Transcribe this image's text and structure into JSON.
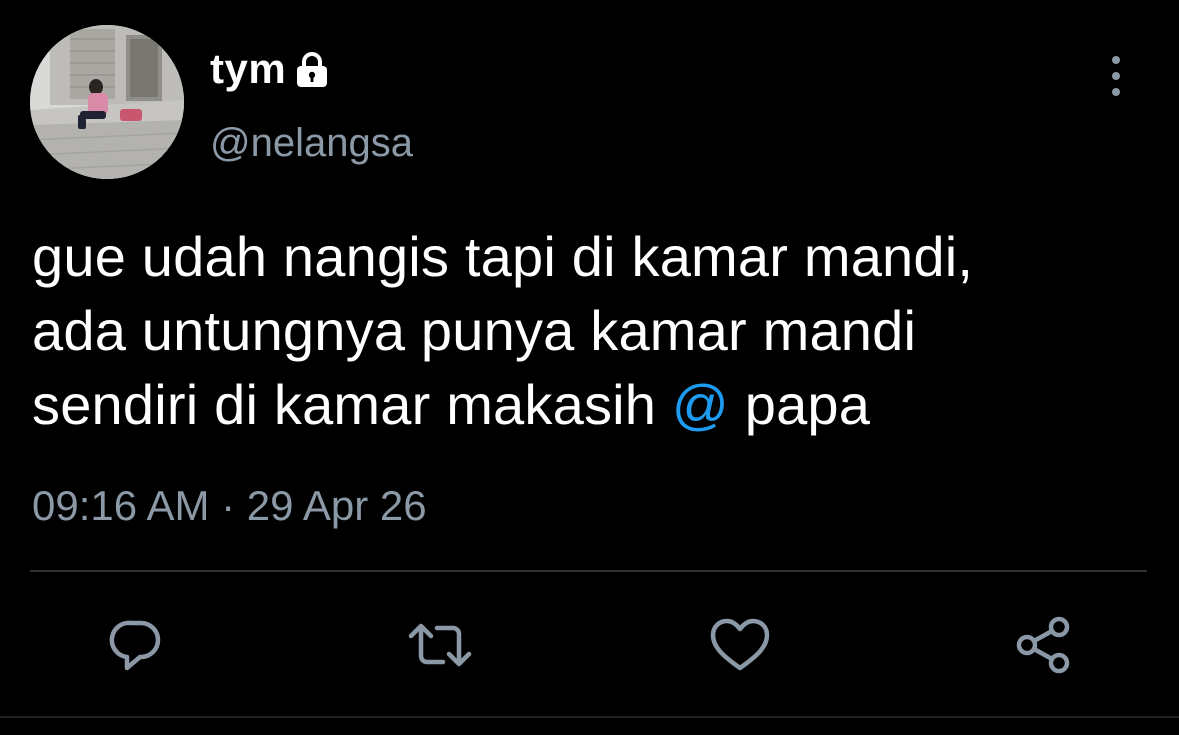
{
  "author": {
    "display_name": "tym",
    "handle": "@nelangsa",
    "protected_icon": "lock-icon",
    "avatar_description": "avatar-photo"
  },
  "tweet": {
    "lines": [
      "gue udah nangis tapi di kamar mandi,",
      "ada untungnya punya kamar mandi",
      "sendiri di kamar makasih "
    ],
    "mention": "@",
    "after_mention": " papa",
    "timestamp": "09:16 AM · 29 Apr 26"
  },
  "actions": [
    {
      "name": "reply",
      "icon": "reply-icon"
    },
    {
      "name": "retweet",
      "icon": "retweet-icon"
    },
    {
      "name": "like",
      "icon": "heart-icon"
    },
    {
      "name": "share",
      "icon": "share-icon"
    }
  ],
  "colors": {
    "background": "#000000",
    "text": "#ffffff",
    "muted": "#8b98a5",
    "mention": "#1d9bf0",
    "divider": "#2f3336"
  }
}
